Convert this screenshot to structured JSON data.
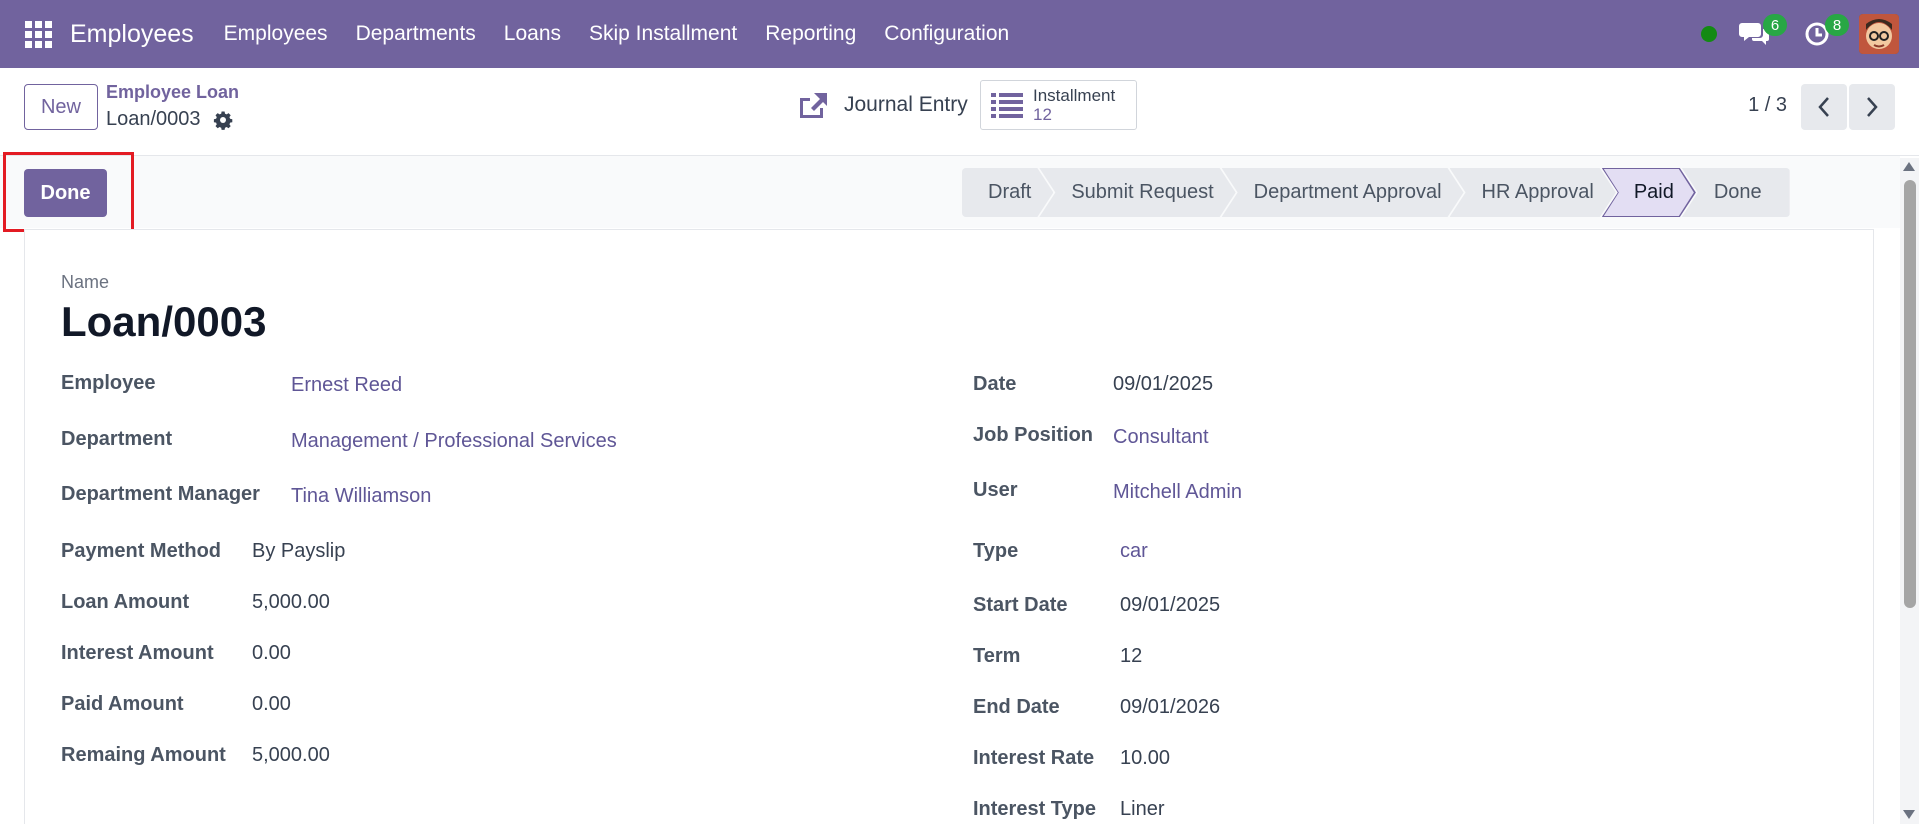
{
  "navbar": {
    "app_name": "Employees",
    "menu": [
      "Employees",
      "Departments",
      "Loans",
      "Skip Installment",
      "Reporting",
      "Configuration"
    ],
    "messages_count": "6",
    "activities_count": "8"
  },
  "control": {
    "new_label": "New",
    "breadcrumb_parent": "Employee Loan",
    "breadcrumb_current": "Loan/0003",
    "journal_entry_label": "Journal Entry",
    "installment_label": "Installment",
    "installment_count": "12",
    "pager": "1 / 3"
  },
  "statusbar": {
    "done_button": "Done",
    "stages": [
      "Draft",
      "Submit Request",
      "Department Approval",
      "HR Approval",
      "Paid",
      "Done"
    ],
    "active_stage": "Paid"
  },
  "form": {
    "name_label": "Name",
    "name_value": "Loan/0003",
    "left": [
      {
        "label": "Employee",
        "value": "Ernest Reed"
      },
      {
        "label": "Department",
        "value": "Management / Professional Services"
      },
      {
        "label": "Department Manager",
        "value": "Tina Williamson"
      },
      {
        "label": "Payment Method",
        "value": "By Payslip"
      },
      {
        "label": "Loan Amount",
        "value": "5,000.00"
      },
      {
        "label": "Interest Amount",
        "value": "0.00"
      },
      {
        "label": "Paid Amount",
        "value": "0.00"
      },
      {
        "label": "Remaing Amount",
        "value": "5,000.00"
      }
    ],
    "right": [
      {
        "label": "Date",
        "value": "09/01/2025"
      },
      {
        "label": "Job Position",
        "value": "Consultant"
      },
      {
        "label": "User",
        "value": "Mitchell Admin"
      },
      {
        "label": "Type",
        "value": "car"
      },
      {
        "label": "Start Date",
        "value": "09/01/2025"
      },
      {
        "label": "Term",
        "value": "12"
      },
      {
        "label": "End Date",
        "value": "09/01/2026"
      },
      {
        "label": "Interest Rate",
        "value": "10.00"
      },
      {
        "label": "Interest Type",
        "value": "Liner"
      }
    ]
  },
  "colors": {
    "brand": "#71639e",
    "link": "#5f5696",
    "status_online": "#138a13",
    "badge": "#28a745",
    "highlight": "#e31b23"
  }
}
